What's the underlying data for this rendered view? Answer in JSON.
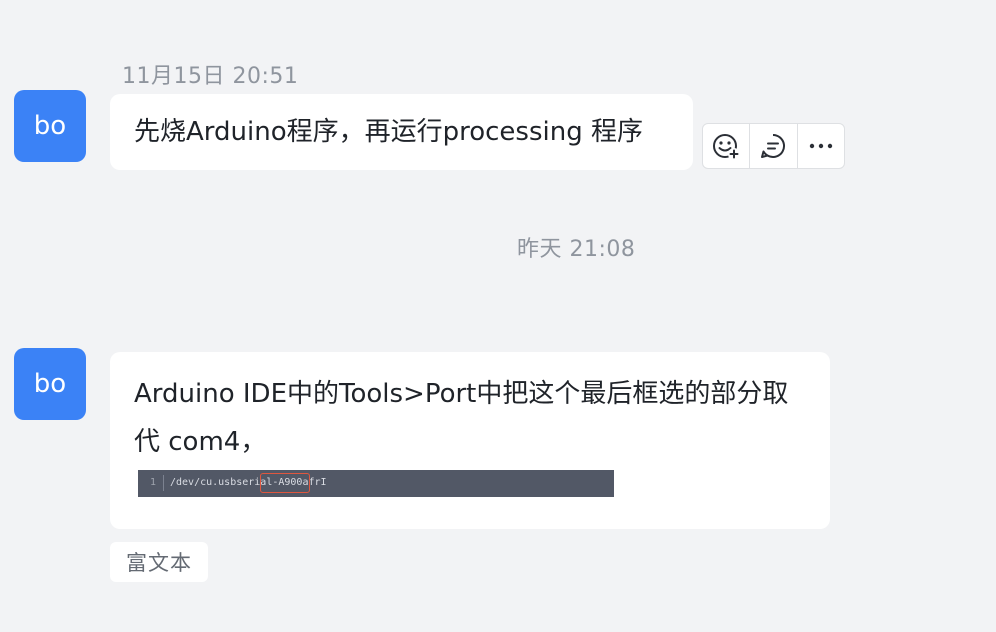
{
  "messages": [
    {
      "timestamp": "11月15日 20:51",
      "avatar": "bo",
      "text": "先烧Arduino程序，再运行processing 程序"
    },
    {
      "timestamp": "昨天 21:08",
      "avatar": "bo",
      "text": "Arduino IDE中的Tools>Port中把这个最后框选的部分取代 com4，",
      "code_snippet": {
        "line_number": "1",
        "prefix": "/dev/cu.usbserial-",
        "highlighted": "A900afrI"
      }
    }
  ],
  "actions": [
    {
      "icon": "add-emoji-icon"
    },
    {
      "icon": "reply-icon"
    },
    {
      "icon": "more-icon"
    }
  ],
  "tag_label": "富文本",
  "colors": {
    "avatar": "#3b82f6",
    "background": "#f2f3f5",
    "highlight_border": "#e0573f"
  }
}
